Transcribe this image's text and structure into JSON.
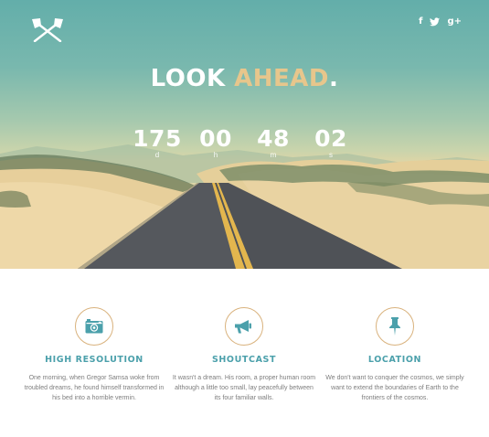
{
  "header": {
    "logo": "crossed-axes-logo",
    "social": [
      {
        "icon": "facebook-icon",
        "glyph": "f"
      },
      {
        "icon": "twitter-icon",
        "glyph": "t"
      },
      {
        "icon": "google-plus-icon",
        "glyph": "g+"
      }
    ]
  },
  "hero": {
    "headline_main": "LOOK",
    "headline_accent": "AHEAD",
    "headline_end": ".",
    "countdown": [
      {
        "value": "175",
        "unit": "d"
      },
      {
        "value": "00",
        "unit": "h"
      },
      {
        "value": "48",
        "unit": "m"
      },
      {
        "value": "02",
        "unit": "s"
      }
    ]
  },
  "features": [
    {
      "icon": "camera-icon",
      "title": "HIGH RESOLUTION",
      "description": "One morning, when Gregor Samsa woke from troubled dreams, he found himself transformed in his bed into a horrible vermin."
    },
    {
      "icon": "megaphone-icon",
      "title": "SHOUTCAST",
      "description": "It wasn't a dream. His room, a proper human room although a little too small, lay peacefully between its four familiar walls."
    },
    {
      "icon": "pushpin-icon",
      "title": "LOCATION",
      "description": "We don't want to conquer the cosmos, we simply want to extend the boundaries of Earth to the frontiers of the cosmos."
    }
  ],
  "colors": {
    "accent_gold": "#e7c68c",
    "teal_title": "#4ba0ab",
    "circle_border": "#d9b27d"
  }
}
